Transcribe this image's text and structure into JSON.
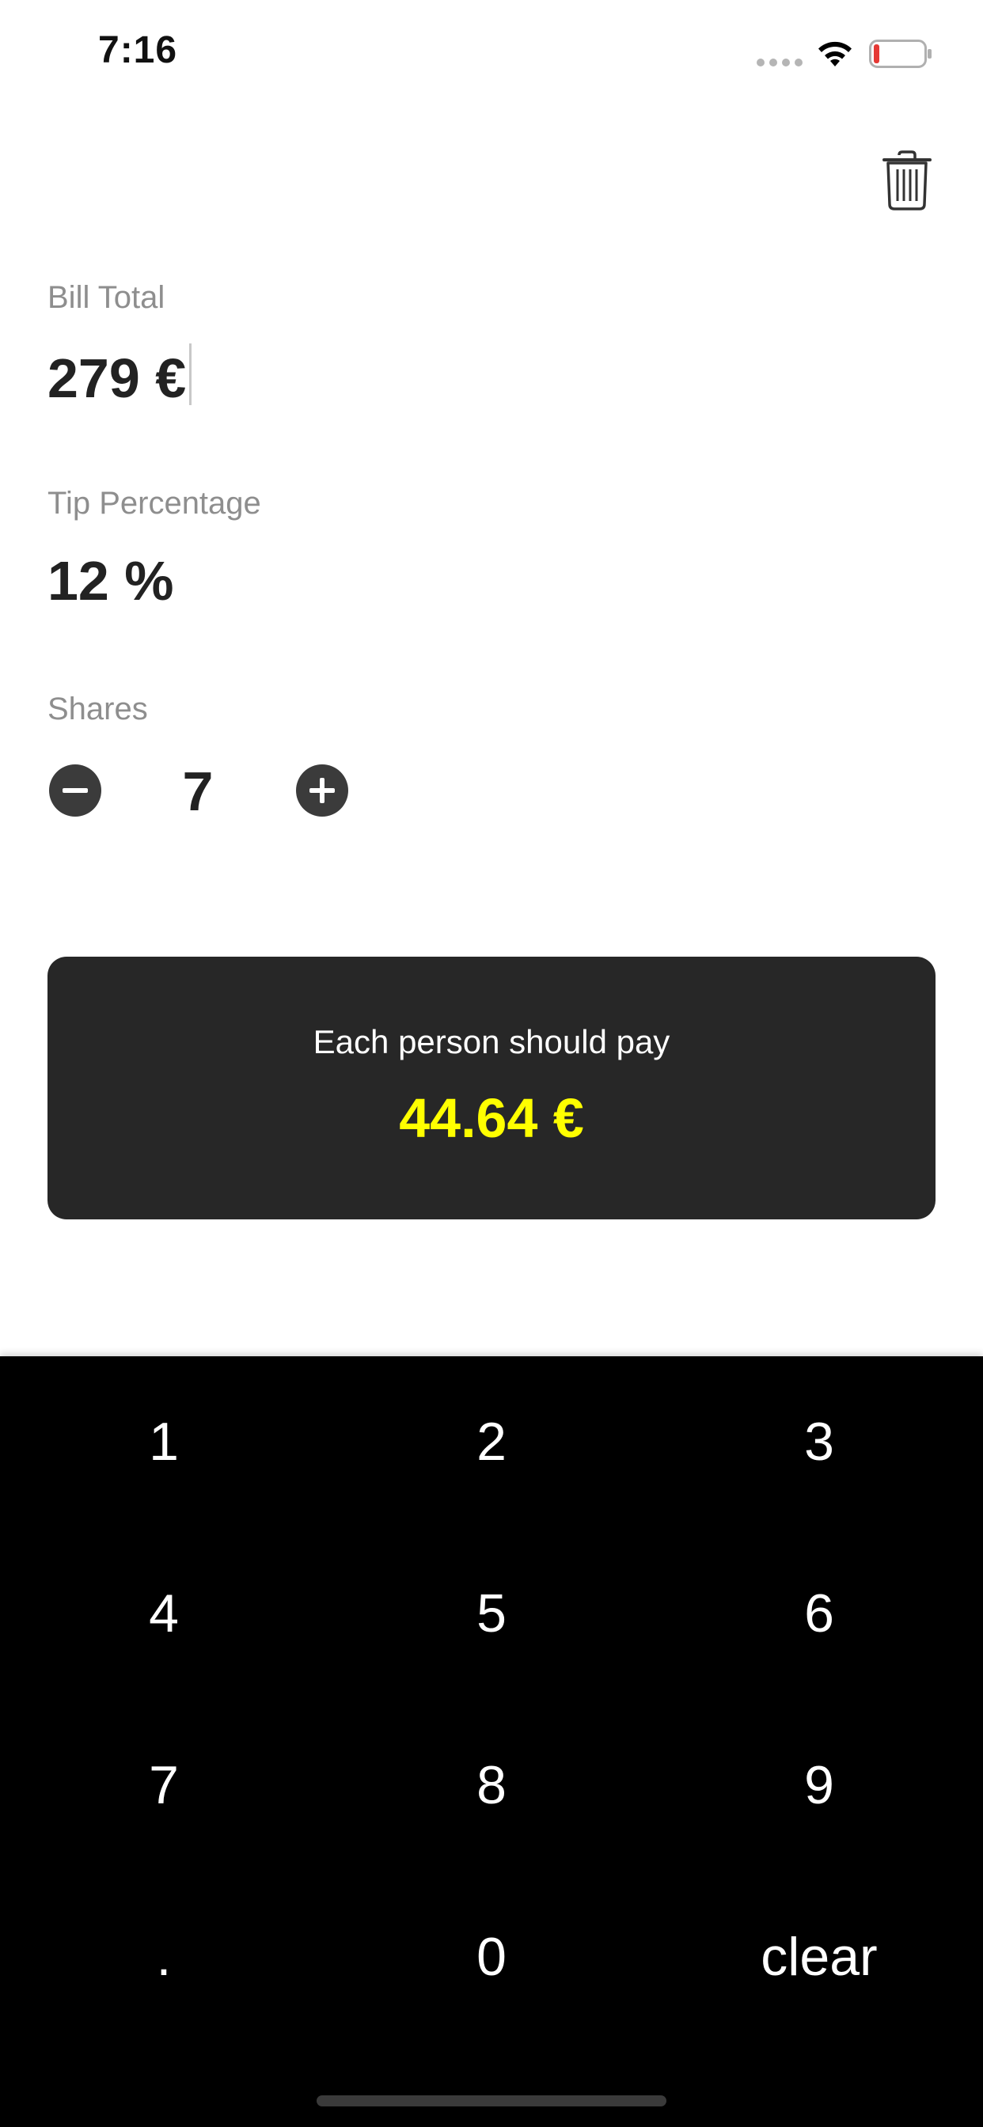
{
  "status_bar": {
    "time": "7:16"
  },
  "bill": {
    "label": "Bill Total",
    "value": "279 €"
  },
  "tip": {
    "label": "Tip Percentage",
    "value": "12 %"
  },
  "shares": {
    "label": "Shares",
    "count": "7"
  },
  "result": {
    "label": "Each person should pay",
    "value": "44.64 €",
    "value_color": "#ffff00"
  },
  "keypad": {
    "keys": [
      "1",
      "2",
      "3",
      "4",
      "5",
      "6",
      "7",
      "8",
      "9",
      ".",
      "0",
      "clear"
    ]
  },
  "icons": {
    "trash": "trash-icon",
    "minus": "minus-circle-icon",
    "plus": "plus-circle-icon",
    "wifi": "wifi-icon",
    "battery": "battery-icon",
    "signal": "cellular-signal-icon"
  },
  "colors": {
    "card_background": "#272727",
    "keypad_background": "#000000",
    "battery_low": "#e53935"
  }
}
